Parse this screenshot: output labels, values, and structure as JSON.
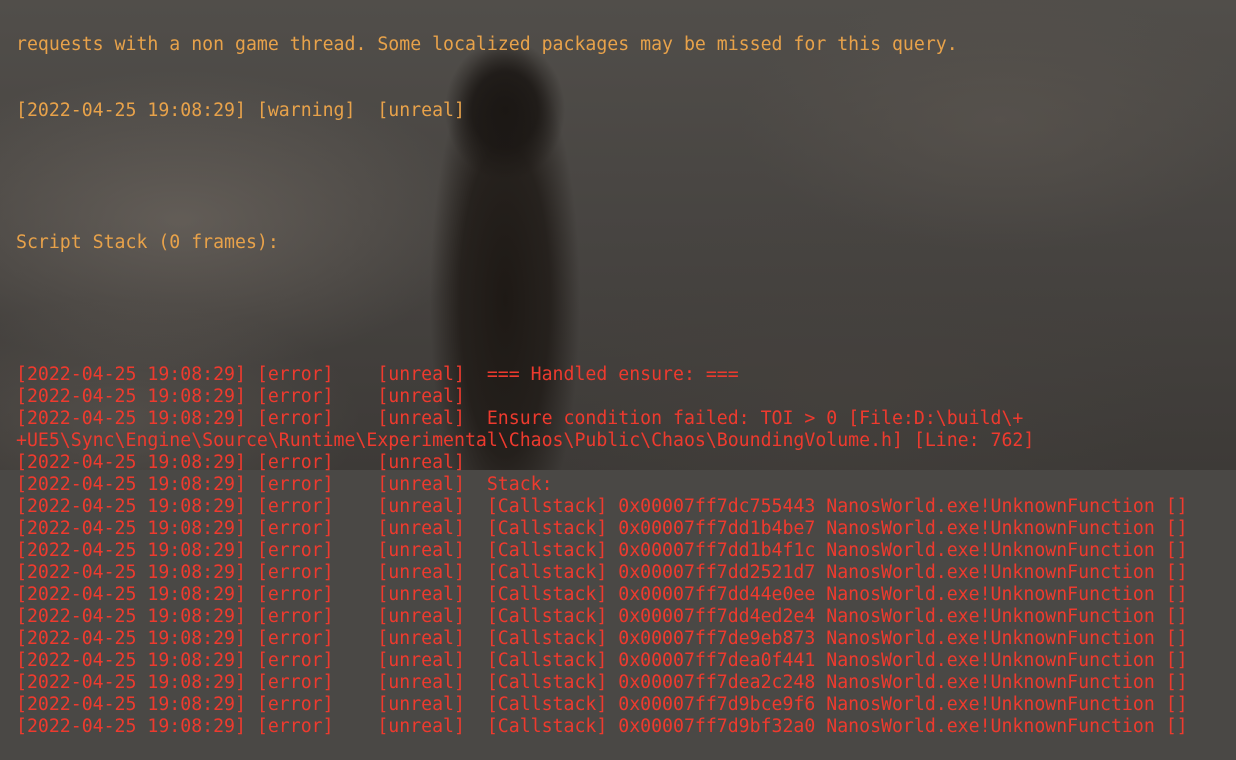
{
  "colors": {
    "warning": "#e8a24a",
    "error": "#ee3a2e"
  },
  "top_partial": "requests with a non game thread. Some localized packages may be missed for this query.",
  "warning_line": "[2022-04-25 19:08:29] [warning]  [unreal]",
  "script_stack": "Script Stack (0 frames):",
  "error_lines": [
    "[2022-04-25 19:08:29] [error]    [unreal]  === Handled ensure: ===",
    "[2022-04-25 19:08:29] [error]    [unreal]",
    "[2022-04-25 19:08:29] [error]    [unreal]  Ensure condition failed: TOI > 0 [File:D:\\build\\+",
    "+UE5\\Sync\\Engine\\Source\\Runtime\\Experimental\\Chaos\\Public\\Chaos\\BoundingVolume.h] [Line: 762]",
    "[2022-04-25 19:08:29] [error]    [unreal]",
    "[2022-04-25 19:08:29] [error]    [unreal]  Stack:",
    "[2022-04-25 19:08:29] [error]    [unreal]  [Callstack] 0x00007ff7dc755443 NanosWorld.exe!UnknownFunction []",
    "[2022-04-25 19:08:29] [error]    [unreal]  [Callstack] 0x00007ff7dd1b4be7 NanosWorld.exe!UnknownFunction []",
    "[2022-04-25 19:08:29] [error]    [unreal]  [Callstack] 0x00007ff7dd1b4f1c NanosWorld.exe!UnknownFunction []",
    "[2022-04-25 19:08:29] [error]    [unreal]  [Callstack] 0x00007ff7dd2521d7 NanosWorld.exe!UnknownFunction []",
    "[2022-04-25 19:08:29] [error]    [unreal]  [Callstack] 0x00007ff7dd44e0ee NanosWorld.exe!UnknownFunction []",
    "[2022-04-25 19:08:29] [error]    [unreal]  [Callstack] 0x00007ff7dd4ed2e4 NanosWorld.exe!UnknownFunction []",
    "[2022-04-25 19:08:29] [error]    [unreal]  [Callstack] 0x00007ff7de9eb873 NanosWorld.exe!UnknownFunction []",
    "[2022-04-25 19:08:29] [error]    [unreal]  [Callstack] 0x00007ff7dea0f441 NanosWorld.exe!UnknownFunction []",
    "[2022-04-25 19:08:29] [error]    [unreal]  [Callstack] 0x00007ff7dea2c248 NanosWorld.exe!UnknownFunction []",
    "[2022-04-25 19:08:29] [error]    [unreal]  [Callstack] 0x00007ff7d9bce9f6 NanosWorld.exe!UnknownFunction []",
    "[2022-04-25 19:08:29] [error]    [unreal]  [Callstack] 0x00007ff7d9bf32a0 NanosWorld.exe!UnknownFunction []"
  ]
}
